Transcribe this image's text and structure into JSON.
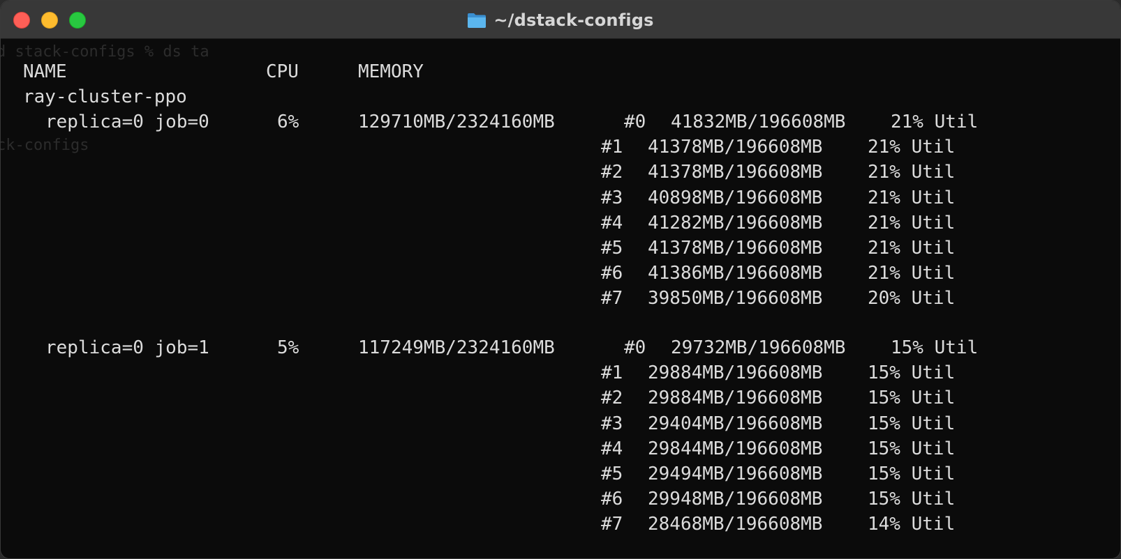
{
  "window": {
    "title": "~/dstack-configs",
    "colors": {
      "titlebar": "#383838",
      "background": "#0b0b0b",
      "text": "#dcdcdc",
      "close": "#fe5f57",
      "minimize": "#febc2e",
      "zoom": "#28c840",
      "folder": "#5bb6ee"
    }
  },
  "ghost_text": {
    "line1": "d stack-configs % ds ta",
    "line2": "ck-configs"
  },
  "header": {
    "name": "NAME",
    "cpu": "CPU",
    "memory": "MEMORY"
  },
  "run_name": "ray-cluster-ppo",
  "jobs": [
    {
      "name": "replica=0 job=0",
      "cpu": "6%",
      "memory": "129710MB/2324160MB",
      "gpus": [
        {
          "id": "#0",
          "memory": "41832MB/196608MB",
          "util": "21% Util"
        },
        {
          "id": "#1",
          "memory": "41378MB/196608MB",
          "util": "21% Util"
        },
        {
          "id": "#2",
          "memory": "41378MB/196608MB",
          "util": "21% Util"
        },
        {
          "id": "#3",
          "memory": "40898MB/196608MB",
          "util": "21% Util"
        },
        {
          "id": "#4",
          "memory": "41282MB/196608MB",
          "util": "21% Util"
        },
        {
          "id": "#5",
          "memory": "41378MB/196608MB",
          "util": "21% Util"
        },
        {
          "id": "#6",
          "memory": "41386MB/196608MB",
          "util": "21% Util"
        },
        {
          "id": "#7",
          "memory": "39850MB/196608MB",
          "util": "20% Util"
        }
      ]
    },
    {
      "name": "replica=0 job=1",
      "cpu": "5%",
      "memory": "117249MB/2324160MB",
      "gpus": [
        {
          "id": "#0",
          "memory": "29732MB/196608MB",
          "util": "15% Util"
        },
        {
          "id": "#1",
          "memory": "29884MB/196608MB",
          "util": "15% Util"
        },
        {
          "id": "#2",
          "memory": "29884MB/196608MB",
          "util": "15% Util"
        },
        {
          "id": "#3",
          "memory": "29404MB/196608MB",
          "util": "15% Util"
        },
        {
          "id": "#4",
          "memory": "29844MB/196608MB",
          "util": "15% Util"
        },
        {
          "id": "#5",
          "memory": "29494MB/196608MB",
          "util": "15% Util"
        },
        {
          "id": "#6",
          "memory": "29948MB/196608MB",
          "util": "15% Util"
        },
        {
          "id": "#7",
          "memory": "28468MB/196608MB",
          "util": "14% Util"
        }
      ]
    }
  ]
}
